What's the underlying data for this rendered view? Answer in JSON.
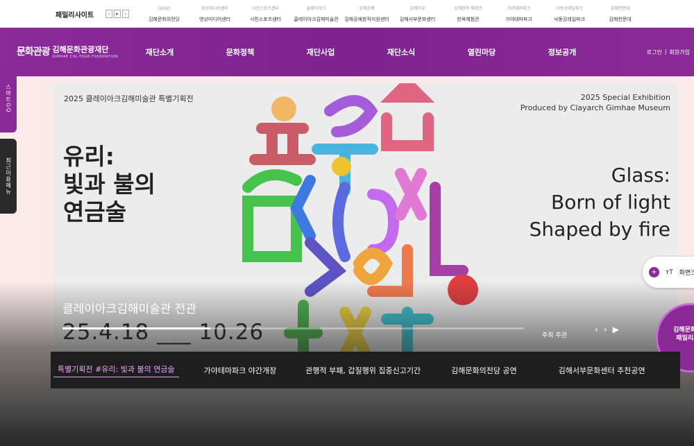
{
  "family_bar": {
    "title": "패밀리사이트",
    "arrows": [
      "‹",
      "▸",
      "›"
    ],
    "sites": [
      {
        "logo": "GASO",
        "label": "김해문화의전당"
      },
      {
        "logo": "영상미디어센터",
        "label": "영상미디어센터"
      },
      {
        "logo": "시민스포츠센터",
        "label": "시민스포츠센터"
      },
      {
        "logo": "클레이아크",
        "label": "클레이아크김해미술관"
      },
      {
        "logo": "김해공예",
        "label": "김해공예창작지원센터"
      },
      {
        "logo": "김해서부",
        "label": "김해서부문화센터"
      },
      {
        "logo": "김해한옥 체험관",
        "label": "한옥체험관"
      },
      {
        "logo": "가야테마파크",
        "label": "가야테마파크"
      },
      {
        "logo": "낙동강레일파크",
        "label": "낙동강레일파크"
      },
      {
        "logo": "김해천문대",
        "label": "김해천문대"
      }
    ]
  },
  "header": {
    "logo_mark": "문화관광",
    "logo_ko": "김해문화관광재단",
    "logo_en": "GIMHAE CUL-TOUR FOUNDATION",
    "menu": [
      "재단소개",
      "문화정책",
      "재단사업",
      "재단소식",
      "열린마당",
      "정보공개"
    ],
    "login": "로그인",
    "separator": "|",
    "signup": "회원가입"
  },
  "side_tabs": {
    "smart": "스마트GQ",
    "recent": "최근이용메뉴"
  },
  "hero": {
    "top_left": "2025 클레이아크김해미술관 특별기획전",
    "top_right_1": "2025 Special Exhibition",
    "top_right_2": "Produced by Clayarch Gimhae Museum",
    "title_ko": [
      "유리:",
      "빛과 불의",
      "연금술"
    ],
    "title_en": [
      "Glass:",
      "Born of light",
      "Shaped by fire"
    ],
    "caption": "클레이아크김해미술관 전관",
    "dates": "25.4.18 ___ 10.26",
    "host": "주최 주관",
    "progress": 0.32,
    "controls": [
      "‹",
      "›",
      "▶"
    ]
  },
  "font_size_tool": {
    "plus": "+",
    "icon": "тT",
    "label": "화면크"
  },
  "family_badge": {
    "line1": "김해문화관광",
    "line2": "패밀리사이"
  },
  "bottom_tabs": [
    "특별기획전 #유리: 빛과 불의 연금술",
    "가야테마파크 야간개장",
    "관행적 부패, 갑질행위 집중신고기간",
    "김해문화의전당 공연",
    "김해서부문화센터 추천공연"
  ],
  "colors": {
    "brand_purple": "#8a2896",
    "accent_pink": "#f0a2ff"
  }
}
